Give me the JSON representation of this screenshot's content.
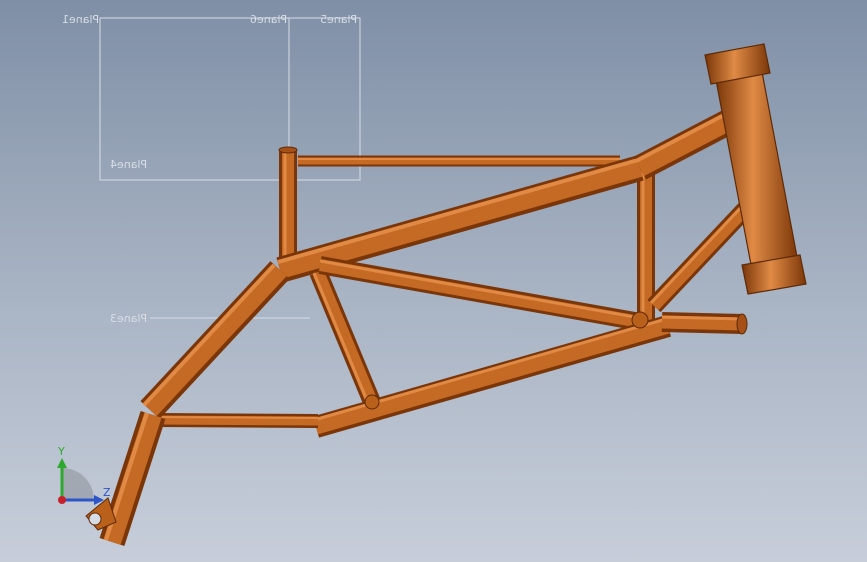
{
  "viewport": {
    "background_top": "#7f8fa6",
    "background_bottom": "#c7ceda"
  },
  "planes": {
    "plane1": "Plane1",
    "plane6": "Plane6",
    "plane5": "Plane5",
    "plane4": "Plane4",
    "plane3": "Plane3"
  },
  "model": {
    "name": "bicycle-frame",
    "tube_color": "#b9601a",
    "tube_shadow": "#7a3608",
    "tube_highlight": "#e08a45"
  },
  "triad": {
    "y_label": "Y",
    "z_label": "Z",
    "y_color": "#2fa82f",
    "z_color": "#2d55c8",
    "x_color": "#c8202a"
  }
}
